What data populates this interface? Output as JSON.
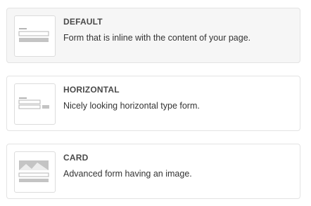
{
  "form_types": [
    {
      "title": "DEFAULT",
      "description": "Form that is inline with the content of your page.",
      "icon": "default-form-layout-icon",
      "selected": true
    },
    {
      "title": "HORIZONTAL",
      "description": "Nicely looking horizontal type form.",
      "icon": "horizontal-form-layout-icon",
      "selected": false
    },
    {
      "title": "CARD",
      "description": "Advanced form having an image.",
      "icon": "card-form-layout-icon",
      "selected": false
    }
  ],
  "colors": {
    "thumb_line": "#b5b5b5",
    "thumb_bar": "#c4c4c4",
    "selected_bg": "#f6f6f6"
  }
}
